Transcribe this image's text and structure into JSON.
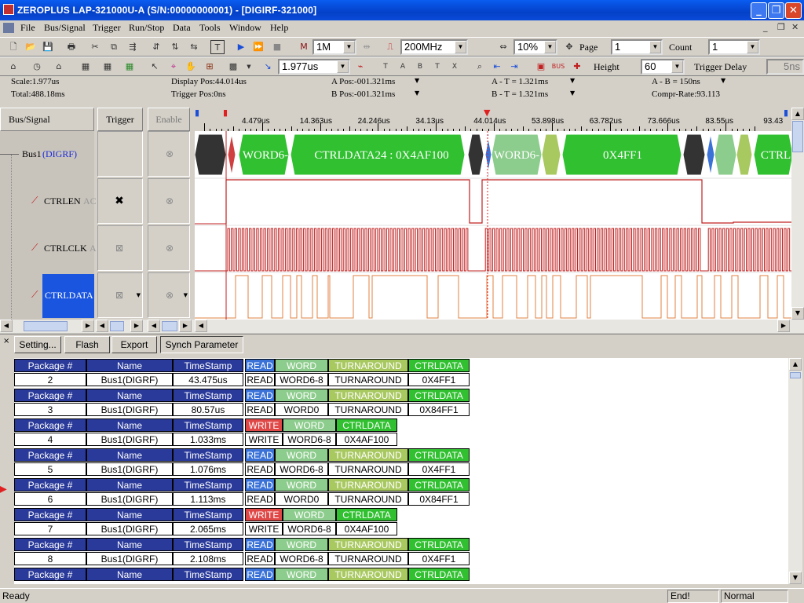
{
  "window": {
    "title": "ZEROPLUS LAP-321000U-A (S/N:00000000001) - [DIGIRF-321000]"
  },
  "menu": [
    "File",
    "Bus/Signal",
    "Trigger",
    "Run/Stop",
    "Data",
    "Tools",
    "Window",
    "Help"
  ],
  "toolbar1": {
    "memory": "1M",
    "frequency": "200MHz",
    "percent": "10%",
    "page_label": "Page",
    "page_value": "1",
    "count_label": "Count",
    "count_value": "1"
  },
  "toolbar2": {
    "cursor_time": "1.977us",
    "height_label": "Height",
    "height_value": "60",
    "trigger_delay_label": "Trigger Delay",
    "trigger_delay_value": "5ns"
  },
  "info": {
    "scale": "Scale:1.977us",
    "total": "Total:488.18ms",
    "display_pos": "Display Pos:44.014us",
    "trigger_pos": "Trigger Pos:0ns",
    "a_pos": "A Pos:-001.321ms",
    "b_pos": "B Pos:-001.321ms",
    "a_t": "A - T = 1.321ms",
    "b_t": "B - T = 1.321ms",
    "a_b": "A - B = 150ns",
    "compr": "Compr-Rate:93.113"
  },
  "signals": {
    "headers": {
      "bus_signal": "Bus/Signal",
      "trigger": "Trigger",
      "enable": "Enable"
    },
    "bus": {
      "name": "Bus1",
      "tag": "(DIGRF)"
    },
    "items": [
      "CTRLEN",
      "CTRLCLK",
      "CTRLDATA"
    ],
    "ghost": [
      "AC",
      "A",
      ""
    ]
  },
  "ruler": [
    "4.479us",
    "14.363us",
    "24.246us",
    "34.13us",
    "44.014us",
    "53.898us",
    "63.782us",
    "73.666us",
    "83.55us",
    "93.43"
  ],
  "bus_labels": [
    "WORD6-",
    "CTRLDATA24 : 0X4AF100",
    "WORD6-",
    "0X4FF1",
    "CTRL"
  ],
  "bottom_buttons": [
    "Setting...",
    "Flash",
    "Export",
    "Synch Parameter"
  ],
  "packet_headers": {
    "package": "Package #",
    "name": "Name",
    "timestamp": "TimeStamp"
  },
  "packets": [
    {
      "num": "2",
      "name": "Bus1(DIGRF)",
      "ts": "43.475us",
      "fields": [
        [
          "READ",
          "READ"
        ],
        [
          "WORD",
          "WORD6-8"
        ],
        [
          "TURNAROUND",
          "TURNAROUND"
        ],
        [
          "CTRLDATA",
          "0X4FF1"
        ]
      ]
    },
    {
      "num": "3",
      "name": "Bus1(DIGRF)",
      "ts": "80.57us",
      "fields": [
        [
          "READ",
          "READ"
        ],
        [
          "WORD",
          "WORD0"
        ],
        [
          "TURNAROUND",
          "TURNAROUND"
        ],
        [
          "CTRLDATA",
          "0X84FF1"
        ]
      ]
    },
    {
      "num": "4",
      "name": "Bus1(DIGRF)",
      "ts": "1.033ms",
      "fields": [
        [
          "WRITE",
          "WRITE"
        ],
        [
          "WORD",
          "WORD6-8"
        ],
        [
          "CTRLDATA",
          "0X4AF100"
        ]
      ]
    },
    {
      "num": "5",
      "name": "Bus1(DIGRF)",
      "ts": "1.076ms",
      "fields": [
        [
          "READ",
          "READ"
        ],
        [
          "WORD",
          "WORD6-8"
        ],
        [
          "TURNAROUND",
          "TURNAROUND"
        ],
        [
          "CTRLDATA",
          "0X4FF1"
        ]
      ]
    },
    {
      "num": "6",
      "name": "Bus1(DIGRF)",
      "ts": "1.113ms",
      "fields": [
        [
          "READ",
          "READ"
        ],
        [
          "WORD",
          "WORD0"
        ],
        [
          "TURNAROUND",
          "TURNAROUND"
        ],
        [
          "CTRLDATA",
          "0X84FF1"
        ]
      ]
    },
    {
      "num": "7",
      "name": "Bus1(DIGRF)",
      "ts": "2.065ms",
      "fields": [
        [
          "WRITE",
          "WRITE"
        ],
        [
          "WORD",
          "WORD6-8"
        ],
        [
          "CTRLDATA",
          "0X4AF100"
        ]
      ]
    },
    {
      "num": "8",
      "name": "Bus1(DIGRF)",
      "ts": "2.108ms",
      "fields": [
        [
          "READ",
          "READ"
        ],
        [
          "WORD",
          "WORD6-8"
        ],
        [
          "TURNAROUND",
          "TURNAROUND"
        ],
        [
          "CTRLDATA",
          "0X4FF1"
        ]
      ]
    },
    {
      "num": "",
      "name": "",
      "ts": "",
      "fields": [
        [
          "READ",
          ""
        ],
        [
          "WORD",
          ""
        ],
        [
          "TURNAROUND",
          ""
        ],
        [
          "CTRLDATA",
          ""
        ]
      ]
    }
  ],
  "field_colors": {
    "READ": "#3a72d8",
    "WRITE": "#e04848",
    "WORD": "#8ccc8c",
    "TURNAROUND": "#a8c860",
    "CTRLDATA": "#30c030"
  },
  "status": {
    "ready": "Ready",
    "end": "End!",
    "mode": "Normal"
  }
}
